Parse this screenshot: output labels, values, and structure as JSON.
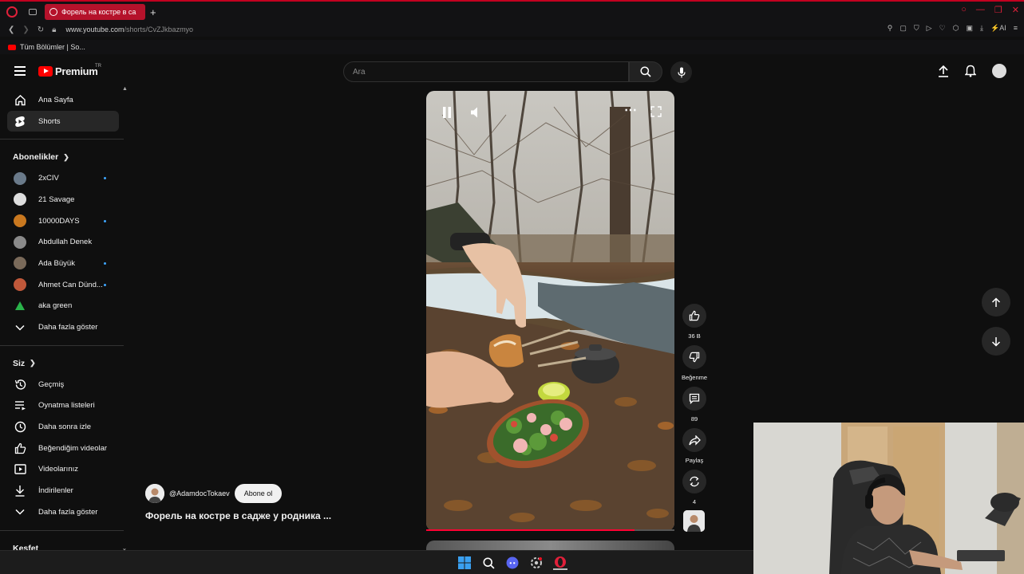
{
  "browser": {
    "tab_title": "Форель на костре в са",
    "url_host": "www.youtube.com",
    "url_path": "/shorts/CvZJkbazmyo",
    "bookmark_label": "Tüm Bölümler | So...",
    "ai_label": "AI"
  },
  "yt": {
    "logo_text": "Premium",
    "logo_region": "TR",
    "search_placeholder": "Ara"
  },
  "sidebar": {
    "main": [
      {
        "label": "Ana Sayfa",
        "icon": "home-icon"
      },
      {
        "label": "Shorts",
        "icon": "shorts-icon",
        "active": true
      }
    ],
    "subscriptions_heading": "Abonelikler",
    "subscriptions": [
      {
        "label": "2xCIV",
        "new": true,
        "color": "#6a7a8a"
      },
      {
        "label": "21 Savage",
        "new": false,
        "color": "#dddddd"
      },
      {
        "label": "10000DAYS",
        "new": true,
        "color": "#c9781f"
      },
      {
        "label": "Abdullah Denek",
        "new": false,
        "color": "#8a8a8a"
      },
      {
        "label": "Ada Büyük",
        "new": true,
        "color": "#7a6a5a"
      },
      {
        "label": "Ahmet Can Dünd...",
        "new": true,
        "color": "#c0583a"
      },
      {
        "label": "aka green",
        "new": false,
        "color": "#2ab34a"
      }
    ],
    "subs_more": "Daha fazla göster",
    "you_heading": "Siz",
    "you_items": [
      {
        "label": "Geçmiş",
        "icon": "history-icon"
      },
      {
        "label": "Oynatma listeleri",
        "icon": "playlist-icon"
      },
      {
        "label": "Daha sonra izle",
        "icon": "clock-icon"
      },
      {
        "label": "Beğendiğim videolar",
        "icon": "like-icon"
      },
      {
        "label": "Videolarınız",
        "icon": "video-icon"
      },
      {
        "label": "İndirilenler",
        "icon": "download-icon"
      }
    ],
    "you_more": "Daha fazla göster",
    "explore_heading": "Keşfet"
  },
  "short": {
    "channel": "@AdamdocTokaev",
    "subscribe": "Abone ol",
    "title": "Форель на костре в садже у родника ...",
    "likes": "36 B",
    "dislike_label": "Beğenme",
    "comments": "89",
    "share_label": "Paylaş",
    "remix_count": "4",
    "progress": 0.84
  },
  "colors": {
    "accent": "#ff0000",
    "progress": "#ff0033",
    "new_dot": "#3ea6ff"
  }
}
